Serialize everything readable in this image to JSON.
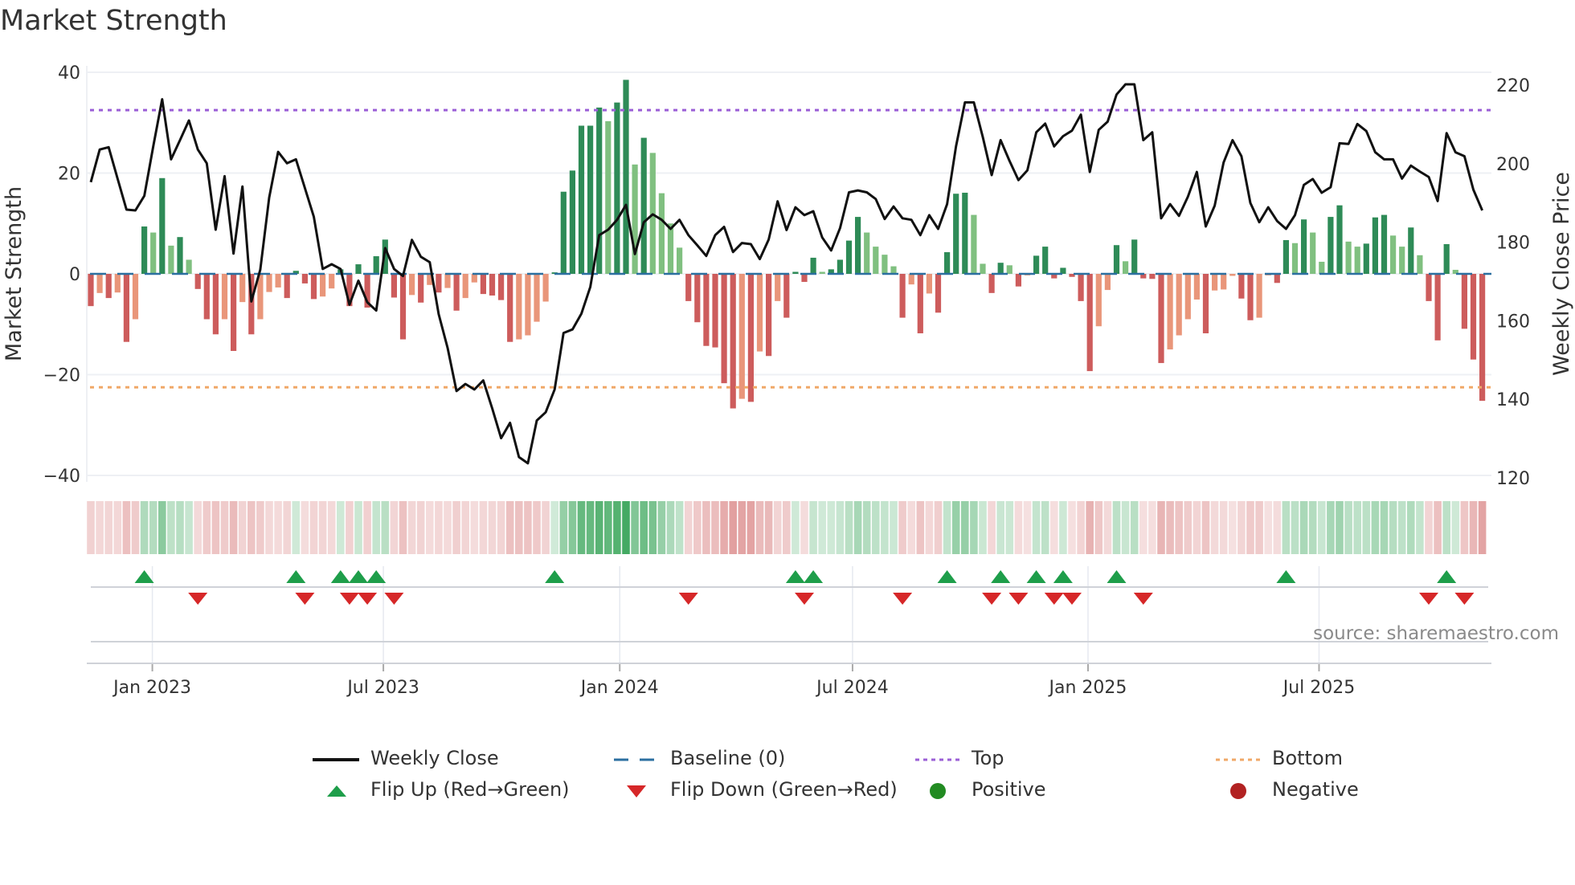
{
  "title": "Market Strength",
  "source": "source: sharemaestro.com",
  "colors": {
    "strong_pos": "#2e8b57",
    "weak_pos": "#80c080",
    "strong_neg": "#cd5c5c",
    "weak_neg": "#e9967a",
    "baseline": "#2b6fa0",
    "top": "#9b5fd6",
    "bottom": "#f0a868",
    "close": "#111111",
    "flip_up": "#1e9e4a",
    "flip_down": "#d62728",
    "positive": "#228b22",
    "negative": "#b22222"
  },
  "chart_data": {
    "type": "bar",
    "title": "Market Strength",
    "ylabel": "Market Strength",
    "y2label": "Weekly Close Price",
    "ylim": [
      -40,
      40
    ],
    "y2lim": [
      120,
      220
    ],
    "yticks": [
      "40",
      "20",
      "0",
      "−20",
      "−40"
    ],
    "ytick_values": [
      40,
      20,
      0,
      -20,
      -40
    ],
    "y2ticks": [
      "220",
      "200",
      "180",
      "160",
      "140",
      "120"
    ],
    "y2tick_values": [
      220,
      200,
      180,
      160,
      140,
      120
    ],
    "xticks": [
      {
        "label": "Jan 2023",
        "week": 6.9
      },
      {
        "label": "Jul 2023",
        "week": 32.8
      },
      {
        "label": "Jan 2024",
        "week": 59.3
      },
      {
        "label": "Jul 2024",
        "week": 85.4
      },
      {
        "label": "Jan 2025",
        "week": 111.8
      },
      {
        "label": "Jul 2025",
        "week": 137.7
      }
    ],
    "top_level": 32.5,
    "bottom_level": -22.5,
    "baseline": 0,
    "strength": [
      -6.4,
      -3.8,
      -4.8,
      -3.7,
      -13.5,
      -9,
      9.4,
      8.2,
      19,
      5.6,
      7.3,
      2.8,
      -3,
      -9,
      -12,
      -9,
      -15.3,
      -5.6,
      -12,
      -9,
      -3.6,
      -2.7,
      -4.8,
      0.6,
      -1.9,
      -5,
      -4.5,
      -2.9,
      0.9,
      -6.4,
      1.9,
      -6.7,
      3.5,
      6.8,
      -4.7,
      -13,
      -4.2,
      -5.7,
      -2.2,
      -3.7,
      -2.8,
      -7.3,
      -4.8,
      -1.7,
      -4,
      -4.3,
      -5.2,
      -13.5,
      -13,
      -12.2,
      -9.5,
      -5.5,
      0.3,
      16.3,
      20.5,
      29.4,
      29.4,
      33,
      30.3,
      34,
      38.5,
      21.7,
      27,
      24,
      16,
      10,
      5.2,
      -5.4,
      -9.6,
      -14.3,
      -14.6,
      -21.7,
      -26.7,
      -24.8,
      -25.4,
      -15.4,
      -16.3,
      -5.4,
      -8.7,
      0.4,
      -1.6,
      3.2,
      0.4,
      0.9,
      2.8,
      6.6,
      11.3,
      8.2,
      5.4,
      3.8,
      1.5,
      -8.7,
      -2.1,
      -11.8,
      -3.9,
      -7.7,
      4.3,
      15.9,
      16.1,
      11.7,
      2,
      -3.8,
      2.2,
      1.7,
      -2.5,
      -0.3,
      3.6,
      5.4,
      -0.9,
      1.2,
      -0.6,
      -5.4,
      -19.3,
      -10.4,
      -3.2,
      5.7,
      2.5,
      6.8,
      -0.9,
      -1,
      -17.7,
      -15,
      -12.2,
      -9,
      -5.1,
      -11.8,
      -3.3,
      -3.1,
      -0.4,
      -4.9,
      -9.2,
      -8.7,
      -0.3,
      -1.8,
      6.7,
      6.1,
      10.8,
      8.2,
      2.4,
      11.3,
      13.6,
      6.4,
      5.4,
      6,
      11.2,
      11.7,
      7.6,
      5.4,
      9.2,
      3.7,
      -5.4,
      -13.2,
      5.9,
      0.8,
      -10.9,
      -17,
      -25.2
    ],
    "weekly_close": [
      195.3,
      203.6,
      204.2,
      196.2,
      188.3,
      188.1,
      191.8,
      204.4,
      216.4,
      201.1,
      206,
      211,
      203.6,
      200.1,
      183.2,
      196.8,
      177.1,
      194.2,
      164.9,
      173,
      191.4,
      203,
      200.1,
      201.1,
      193.8,
      186.5,
      173.2,
      174.4,
      173.2,
      164.1,
      170.2,
      164.7,
      162.6,
      178.5,
      173.2,
      171.4,
      180.6,
      176.3,
      174.9,
      161.7,
      153.1,
      142.1,
      143.9,
      142.5,
      144.8,
      137.7,
      130.1,
      134,
      125.3,
      123.7,
      134.6,
      136.7,
      142.5,
      156.9,
      157.8,
      161.8,
      168.6,
      181.8,
      183.2,
      185.7,
      189.5,
      177,
      185.1,
      187.1,
      185.7,
      183.4,
      185.7,
      181.8,
      179.2,
      176.5,
      181.8,
      183.9,
      177.5,
      179.8,
      179.5,
      175.7,
      180.7,
      190.4,
      183.1,
      188.9,
      186.9,
      187.9,
      181.2,
      177.9,
      183.6,
      192.7,
      193.2,
      192.7,
      191,
      185.9,
      189.1,
      186.1,
      185.7,
      181.8,
      186.9,
      183.4,
      189.7,
      204.4,
      215.6,
      215.6,
      206.8,
      197.1,
      206,
      200.7,
      195.8,
      198.3,
      208,
      210.2,
      204.4,
      207,
      208.4,
      212.5,
      197.9,
      208.6,
      210.7,
      217.6,
      220.2,
      220.2,
      206,
      208,
      186.1,
      189.7,
      186.7,
      191.6,
      197.9,
      184,
      189.3,
      200.3,
      206,
      201.9,
      190,
      185.1,
      188.9,
      185.4,
      183.4,
      186.9,
      194.6,
      196.1,
      192.6,
      194,
      205.2,
      205,
      210.1,
      208.3,
      202.9,
      201.1,
      201.1,
      196.2,
      199.5,
      198,
      196.6,
      190.5,
      207.8,
      202.9,
      201.9,
      193.4,
      188.1
    ],
    "legend": {
      "placement": "bottom",
      "items": [
        {
          "label": "Weekly Close",
          "kind": "line"
        },
        {
          "label": "Baseline (0)",
          "kind": "dash"
        },
        {
          "label": "Top",
          "kind": "dot-top"
        },
        {
          "label": "Bottom",
          "kind": "dot-bottom"
        },
        {
          "label": "Flip Up (Red→Green)",
          "kind": "tri-up"
        },
        {
          "label": "Flip Down (Green→Red)",
          "kind": "tri-down"
        },
        {
          "label": "Positive",
          "kind": "circle-pos"
        },
        {
          "label": "Negative",
          "kind": "circle-neg"
        }
      ]
    }
  }
}
